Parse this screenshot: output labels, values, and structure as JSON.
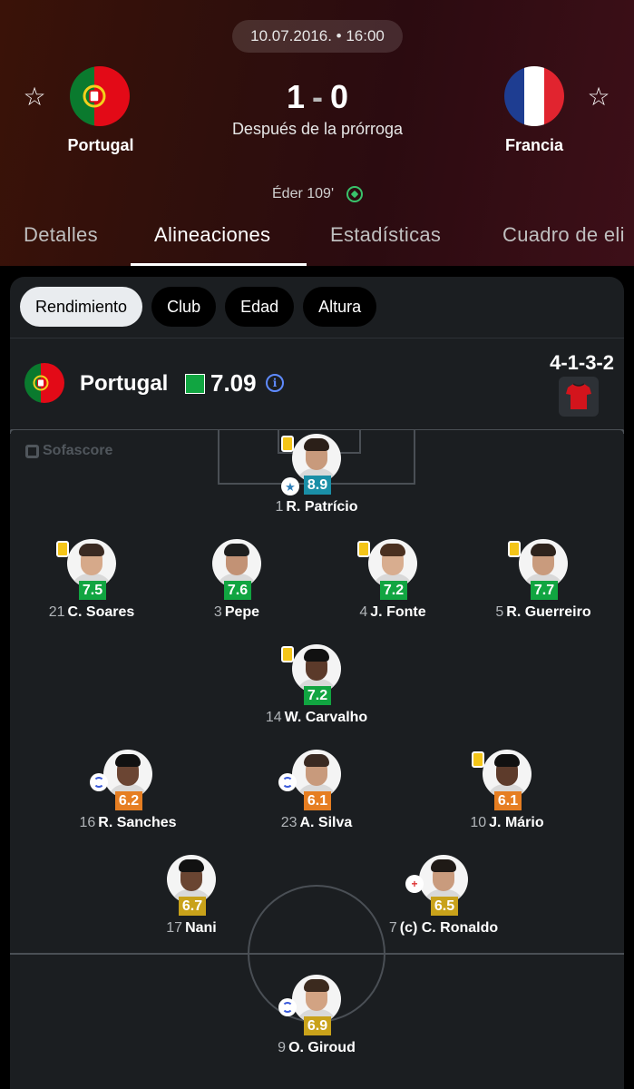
{
  "match": {
    "date_time": "10.07.2016. • 16:00",
    "home": {
      "name": "Portugal",
      "flag": "portugal-flag"
    },
    "away": {
      "name": "Francia",
      "flag": "france-flag"
    },
    "score_home": "1",
    "score_away": "0",
    "score_note": "Después de la prórroga",
    "goal_event": "Éder 109'"
  },
  "tabs": [
    {
      "label": "Detalles",
      "active": false
    },
    {
      "label": "Alineaciones",
      "active": true
    },
    {
      "label": "Estadísticas",
      "active": false
    },
    {
      "label": "Cuadro de eli",
      "active": false
    }
  ],
  "filters": [
    {
      "label": "Rendimiento",
      "active": true
    },
    {
      "label": "Club",
      "active": false
    },
    {
      "label": "Edad",
      "active": false
    },
    {
      "label": "Altura",
      "active": false
    }
  ],
  "lineup": {
    "team_name": "Portugal",
    "team_rating": "7.09",
    "formation": "4-1-3-2",
    "watermark": "Sofascore"
  },
  "colors": {
    "rating_green": "#11a541",
    "rating_teal": "#1a8fa7",
    "rating_orange": "#e67e22",
    "rating_yellow": "#c9a21a",
    "yellow_card": "#f4c518"
  },
  "players": [
    {
      "number": "1",
      "name": "R. Patrício",
      "rating": "8.9",
      "rating_color": "#1a8fa7",
      "yellow": true,
      "motm": true
    },
    {
      "number": "21",
      "name": "C. Soares",
      "rating": "7.5",
      "rating_color": "#11a541",
      "yellow": true
    },
    {
      "number": "3",
      "name": "Pepe",
      "rating": "7.6",
      "rating_color": "#11a541"
    },
    {
      "number": "4",
      "name": "J. Fonte",
      "rating": "7.2",
      "rating_color": "#11a541",
      "yellow": true
    },
    {
      "number": "5",
      "name": "R. Guerreiro",
      "rating": "7.7",
      "rating_color": "#11a541",
      "yellow": true
    },
    {
      "number": "14",
      "name": "W. Carvalho",
      "rating": "7.2",
      "rating_color": "#11a541",
      "yellow": true
    },
    {
      "number": "16",
      "name": "R. Sanches",
      "rating": "6.2",
      "rating_color": "#e67e22",
      "sub": true
    },
    {
      "number": "23",
      "name": "A. Silva",
      "rating": "6.1",
      "rating_color": "#e67e22",
      "sub": true
    },
    {
      "number": "10",
      "name": "J. Mário",
      "rating": "6.1",
      "rating_color": "#e67e22",
      "yellow": true
    },
    {
      "number": "17",
      "name": "Nani",
      "rating": "6.7",
      "rating_color": "#c9a21a"
    },
    {
      "number": "7",
      "name": "(c) C. Ronaldo",
      "rating": "6.5",
      "rating_color": "#c9a21a",
      "injury": true
    },
    {
      "number": "9",
      "name": "O. Giroud",
      "rating": "6.9",
      "rating_color": "#c9a21a",
      "sub": true
    }
  ]
}
